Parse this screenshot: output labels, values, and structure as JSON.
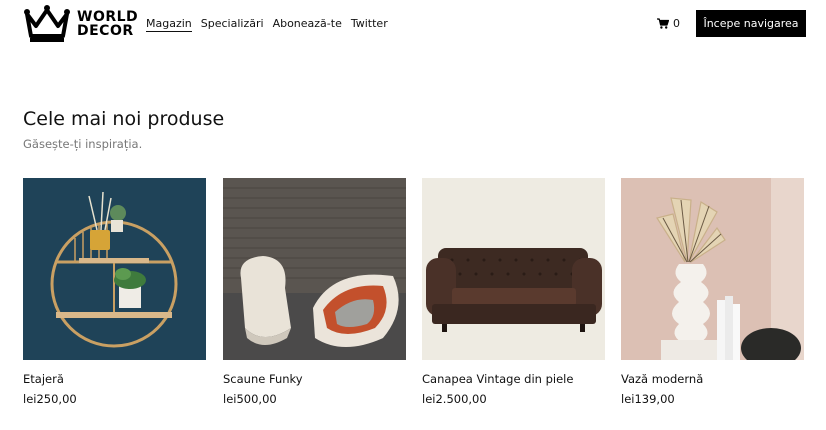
{
  "brand": {
    "line1": "WORLD",
    "line2": "DECOR",
    "logo_icon": "crown-icon"
  },
  "nav": {
    "items": [
      {
        "label": "Magazin",
        "active": true
      },
      {
        "label": "Specializări",
        "active": false
      },
      {
        "label": "Abonează-te",
        "active": false
      },
      {
        "label": "Twitter",
        "active": false
      }
    ]
  },
  "cart": {
    "icon": "cart-icon",
    "count": "0"
  },
  "cta": {
    "label": "Începe navigarea"
  },
  "section": {
    "title": "Cele mai noi produse",
    "subtitle": "Găsește-ți inspirația."
  },
  "products": [
    {
      "name": "Etajeră",
      "price": "lei250,00",
      "image": "round-shelf-image"
    },
    {
      "name": "Scaune Funky",
      "price": "lei500,00",
      "image": "funky-chairs-image"
    },
    {
      "name": "Canapea Vintage din piele",
      "price": "lei2.500,00",
      "image": "leather-sofa-image"
    },
    {
      "name": "Vază modernă",
      "price": "lei139,00",
      "image": "modern-vase-image"
    }
  ],
  "colors": {
    "accent": "#000000",
    "subtitle": "#777777"
  }
}
